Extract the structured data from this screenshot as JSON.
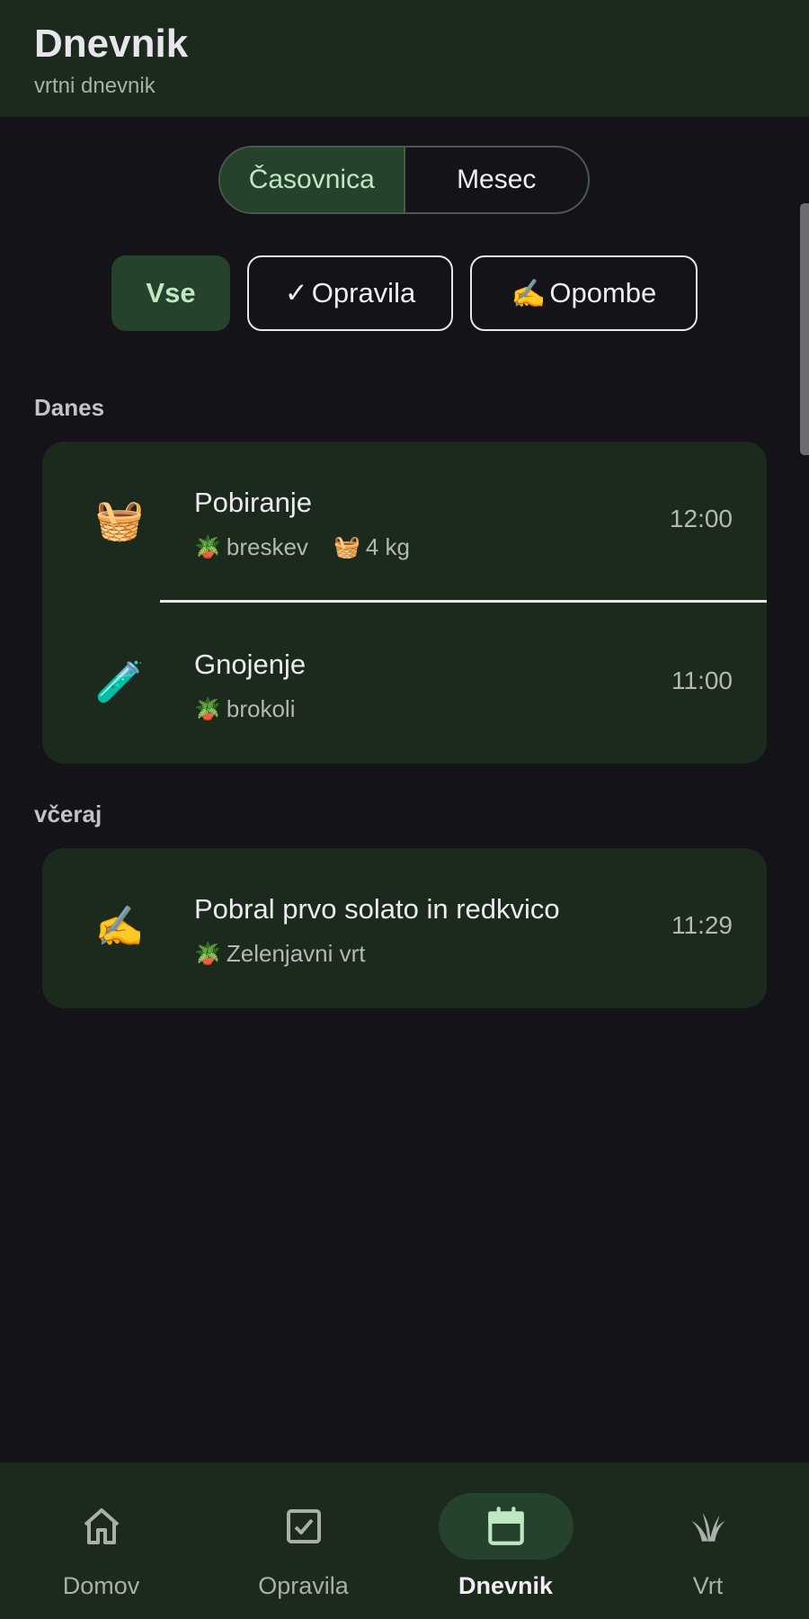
{
  "header": {
    "title": "Dnevnik",
    "subtitle": "vrtni dnevnik"
  },
  "view_toggle": {
    "options": [
      "Časovnica",
      "Mesec"
    ],
    "selected": "Časovnica"
  },
  "filters": {
    "selected": "Vse",
    "items": [
      {
        "icon": "",
        "label": "Vse"
      },
      {
        "icon": "✓",
        "label": "Opravila"
      },
      {
        "icon": "✍️",
        "label": "Opombe"
      }
    ]
  },
  "sections": [
    {
      "label": "Danes",
      "entries": [
        {
          "icon": "basket-icon",
          "icon_glyph": "🧺",
          "title": "Pobiranje",
          "plant_glyph": "🪴",
          "plant": "breskev",
          "amount_glyph": "🧺",
          "amount": "4 kg",
          "time": "12:00"
        },
        {
          "icon": "test-tube-icon",
          "icon_glyph": "🧪",
          "title": "Gnojenje",
          "plant_glyph": "🪴",
          "plant": "brokoli",
          "time": "11:00"
        }
      ]
    },
    {
      "label": "včeraj",
      "entries": [
        {
          "icon": "writing-hand-icon",
          "icon_glyph": "✍️",
          "title": "Pobral prvo solato in redkvico",
          "plant_glyph": "🪴",
          "plant": "Zelenjavni vrt",
          "time": "11:29"
        }
      ]
    }
  ],
  "bottom_nav": {
    "active": "Dnevnik",
    "items": [
      {
        "icon": "home-icon",
        "label": "Domov"
      },
      {
        "icon": "checkbox-icon",
        "label": "Opravila"
      },
      {
        "icon": "calendar-icon",
        "label": "Dnevnik"
      },
      {
        "icon": "sprout-icon",
        "label": "Vrt"
      }
    ]
  },
  "colors": {
    "background": "#15131a",
    "surface": "#1b2a1d",
    "accent_container": "#26422c",
    "accent_text": "#bfe7c1"
  }
}
